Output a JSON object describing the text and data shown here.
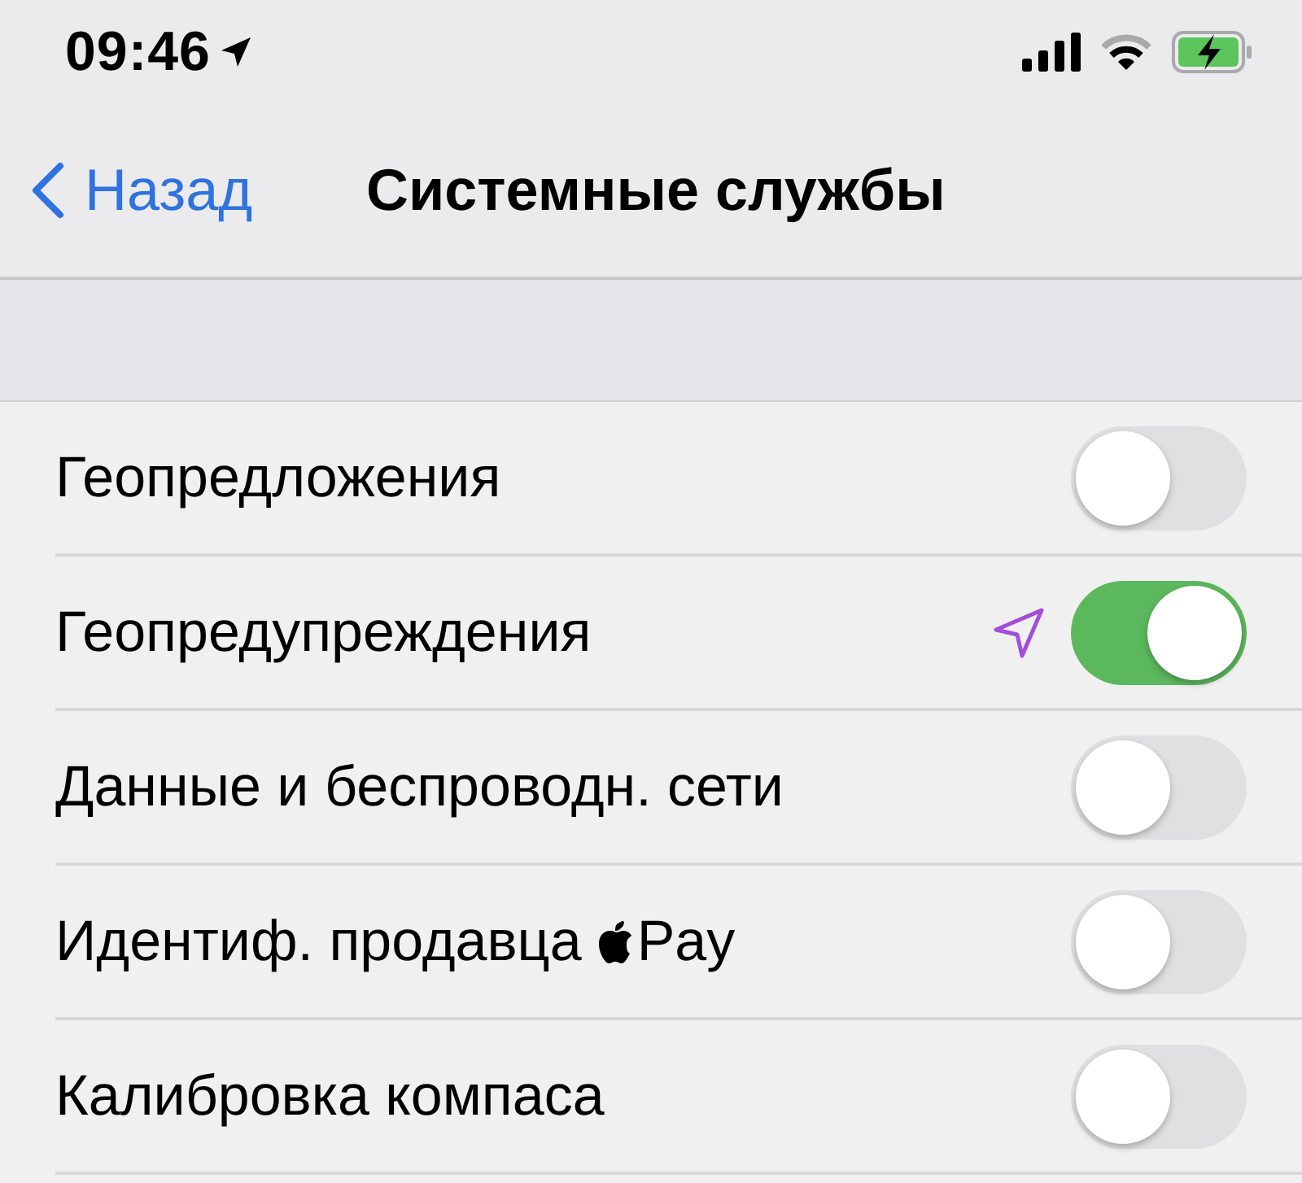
{
  "status_bar": {
    "time": "09:46",
    "location_active": true
  },
  "nav": {
    "back": "Назад",
    "title": "Системные службы"
  },
  "rows": [
    {
      "label": "Геопредложения",
      "on": false,
      "location_used": false
    },
    {
      "label": "Геопредупреждения",
      "on": true,
      "location_used": true
    },
    {
      "label": "Данные и беспроводн. сети",
      "on": false,
      "location_used": false
    },
    {
      "label": "Идентиф. продавца",
      "logo_suffix": "Pay",
      "on": false,
      "location_used": false
    },
    {
      "label": "Калибровка компаса",
      "on": false,
      "location_used": false
    }
  ]
}
